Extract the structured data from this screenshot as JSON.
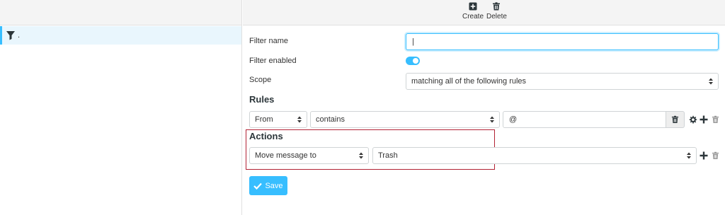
{
  "filter_list": {
    "items": [
      {
        "label": "."
      }
    ]
  },
  "toolbar": {
    "create_label": "Create",
    "delete_label": "Delete"
  },
  "form": {
    "filter_name_label": "Filter name",
    "filter_name_value": "|",
    "filter_enabled_label": "Filter enabled",
    "filter_enabled": true,
    "scope_label": "Scope",
    "scope_value": "matching all of the following rules",
    "rules_heading": "Rules",
    "rule": {
      "header": "From",
      "operator": "contains",
      "value": "@"
    },
    "actions_heading": "Actions",
    "action": {
      "type": "Move message to",
      "target": "Trash"
    },
    "save_label": "Save"
  },
  "colors": {
    "accent": "#37beff",
    "highlight_border": "#b22234",
    "selected_row_bg": "#e9f6fd"
  }
}
